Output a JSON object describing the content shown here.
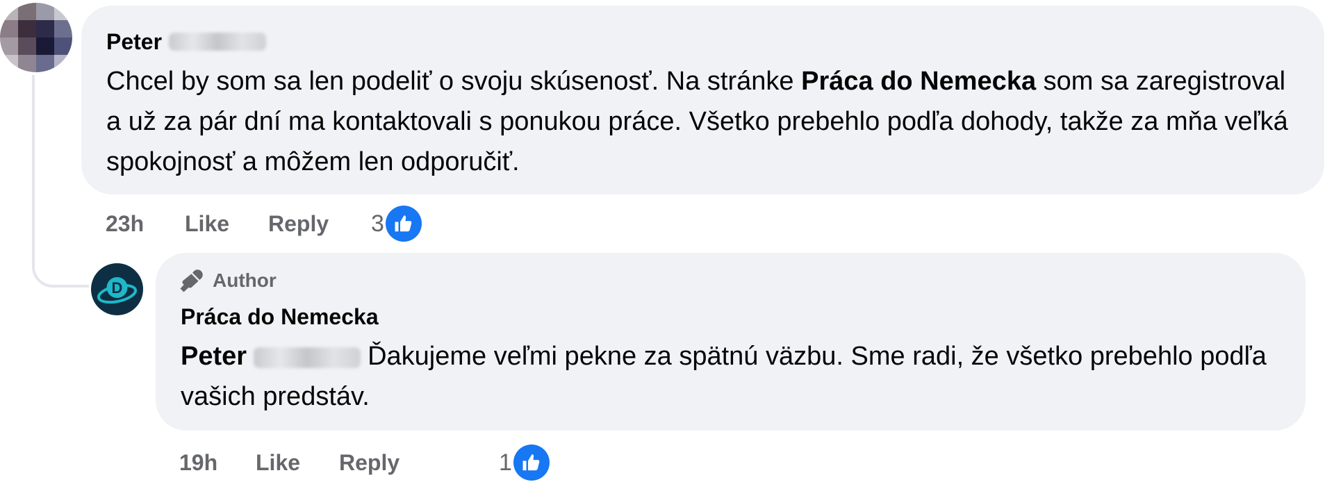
{
  "comment": {
    "author": "Peter",
    "text_before": "Chcel by som sa len podeliť o svoju skúsenosť. Na stránke ",
    "text_bold": "Práca do Nemecka",
    "text_after": " som sa zaregistroval a už za pár dní ma kontaktovali s ponukou práce. Všetko prebehlo podľa dohody, takže za mňa veľká spokojnosť a môžem len odporučiť.",
    "time": "23h",
    "like_label": "Like",
    "reply_label": "Reply",
    "reaction_count": "3",
    "reaction_icon": "thumbs-up-icon"
  },
  "reply": {
    "badge_label": "Author",
    "author": "Práca do Nemecka",
    "mention": "Peter",
    "text": "Ďakujeme veľmi pekne za spätnú väzbu. Sme radi, že všetko prebehlo podľa vašich predstáv.",
    "time": "19h",
    "like_label": "Like",
    "reply_label": "Reply",
    "reaction_count": "1",
    "reaction_icon": "thumbs-up-icon",
    "avatar_letter": "D"
  },
  "colors": {
    "bubble": "#f0f2f5",
    "meta_text": "#65676b",
    "like_blue": "#1877f2",
    "brand_dark": "#0e2f43",
    "brand_teal": "#1fb7c9"
  }
}
